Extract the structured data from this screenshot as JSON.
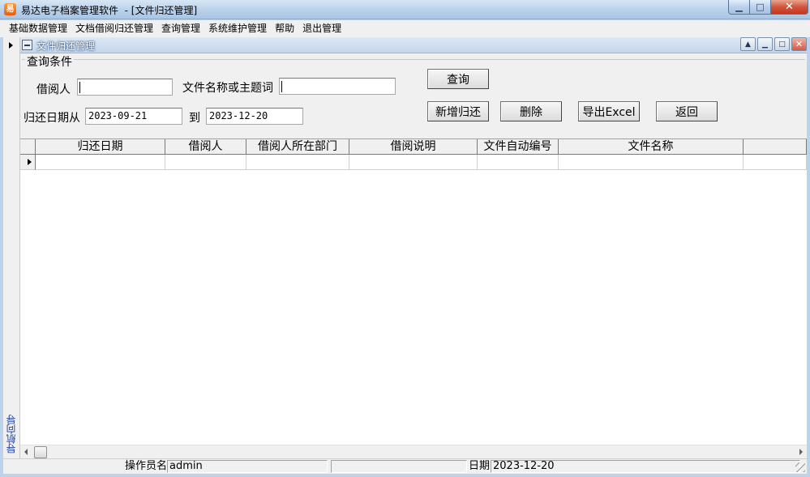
{
  "window": {
    "app_icon": "易",
    "title": "易达电子档案管理软件  - [文件归还管理]",
    "minimize_glyph": "▁",
    "maximize_glyph": "□",
    "close_glyph": "✕"
  },
  "menu": [
    "基础数据管理",
    "文档借阅归还管理",
    "查询管理",
    "系统维护管理",
    "帮助",
    "退出管理"
  ],
  "nav": {
    "label": "导航向导"
  },
  "child_window": {
    "title": "文件归还管理",
    "restore_glyph": "▲",
    "minimize_glyph": "▁",
    "maximize_glyph": "□",
    "close_glyph": "✕"
  },
  "query": {
    "legend": "查询条件",
    "borrower_label": "借阅人",
    "borrower_value": "",
    "filename_label": "文件名称或主题词",
    "filename_value": "",
    "date_from_label": "归还日期从",
    "date_from_value": "2023-09-21",
    "date_to_label": "到",
    "date_to_value": "2023-12-20"
  },
  "buttons": {
    "search": "查询",
    "add_return": "新增归还",
    "delete": "删除",
    "export": "导出Excel",
    "back": "返回"
  },
  "grid": {
    "columns": [
      "归还日期",
      "借阅人",
      "借阅人所在部门",
      "借阅说明",
      "文件自动编号",
      "文件名称"
    ]
  },
  "status": {
    "operator_label": "操作员名",
    "operator_value": "admin",
    "date_label": "日期",
    "date_value": "2023-12-20"
  }
}
